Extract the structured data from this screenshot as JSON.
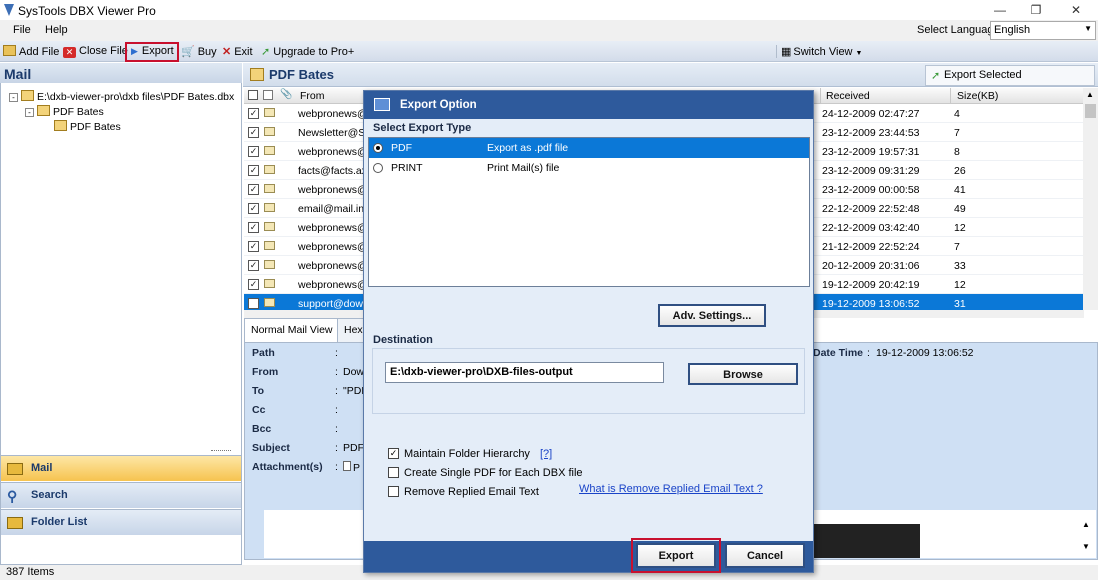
{
  "app": {
    "title": "SysTools DBX Viewer Pro",
    "menu": [
      "File",
      "Help"
    ],
    "language_label": "Select Language:",
    "language_value": "English"
  },
  "toolbar": {
    "add_file": "Add File",
    "close_file": "Close File",
    "export": "Export",
    "buy": "Buy",
    "exit": "Exit",
    "upgrade": "Upgrade to Pro+",
    "switch_view": "Switch View"
  },
  "left": {
    "header": "Mail",
    "tree": [
      "E:\\dxb-viewer-pro\\dxb files\\PDF Bates.dbx",
      "PDF Bates",
      "PDF Bates"
    ],
    "nav": [
      "Mail",
      "Search",
      "Folder List"
    ]
  },
  "status": "387 Items",
  "right": {
    "title": "PDF Bates",
    "export_selected": "Export Selected",
    "columns": {
      "from": "From",
      "received": "Received",
      "size": "Size(KB)"
    },
    "rows": [
      {
        "from": "webpronews@",
        "received": "24-12-2009 02:47:27",
        "size": "4"
      },
      {
        "from": "Newsletter@S",
        "received": "23-12-2009 23:44:53",
        "size": "7"
      },
      {
        "from": "webpronews@",
        "received": "23-12-2009 19:57:31",
        "size": "8"
      },
      {
        "from": "facts@facts.ax",
        "received": "23-12-2009 09:31:29",
        "size": "26"
      },
      {
        "from": "webpronews@",
        "received": "23-12-2009 00:00:58",
        "size": "41"
      },
      {
        "from": "email@mail.inf",
        "received": "22-12-2009 22:52:48",
        "size": "49"
      },
      {
        "from": "webpronews@",
        "received": "22-12-2009 03:42:40",
        "size": "12"
      },
      {
        "from": "webpronews@",
        "received": "21-12-2009 22:52:24",
        "size": "7"
      },
      {
        "from": "webpronews@",
        "received": "20-12-2009 20:31:06",
        "size": "33"
      },
      {
        "from": "webpronews@",
        "received": "19-12-2009 20:42:19",
        "size": "12"
      },
      {
        "from": "support@dow",
        "received": "19-12-2009 13:06:52",
        "size": "31"
      }
    ],
    "tabs": [
      "Normal Mail View",
      "Hex"
    ],
    "details": {
      "labels": [
        "Path",
        "From",
        "To",
        "Cc",
        "Bcc",
        "Subject",
        "Attachment(s)"
      ],
      "values": [
        "Dow",
        "\"PDF",
        "",
        "",
        "PDF",
        "P"
      ],
      "date_label": "Date Time",
      "date_value": "19-12-2009 13:06:52"
    }
  },
  "dialog": {
    "title": "Export Option",
    "type_label": "Select Export Type",
    "types": [
      {
        "name": "PDF",
        "desc": "Export as .pdf file"
      },
      {
        "name": "PRINT",
        "desc": "Print Mail(s) file"
      }
    ],
    "adv_settings": "Adv. Settings...",
    "destination_label": "Destination",
    "destination_path": "E:\\dxb-viewer-pro\\DXB-files-output",
    "browse": "Browse",
    "options": [
      "Maintain Folder Hierarchy",
      "Create Single PDF for Each DBX file",
      "Remove Replied Email Text"
    ],
    "help_mark": "[?]",
    "help_link": "What is Remove Replied Email Text ?",
    "export_btn": "Export",
    "cancel_btn": "Cancel"
  }
}
